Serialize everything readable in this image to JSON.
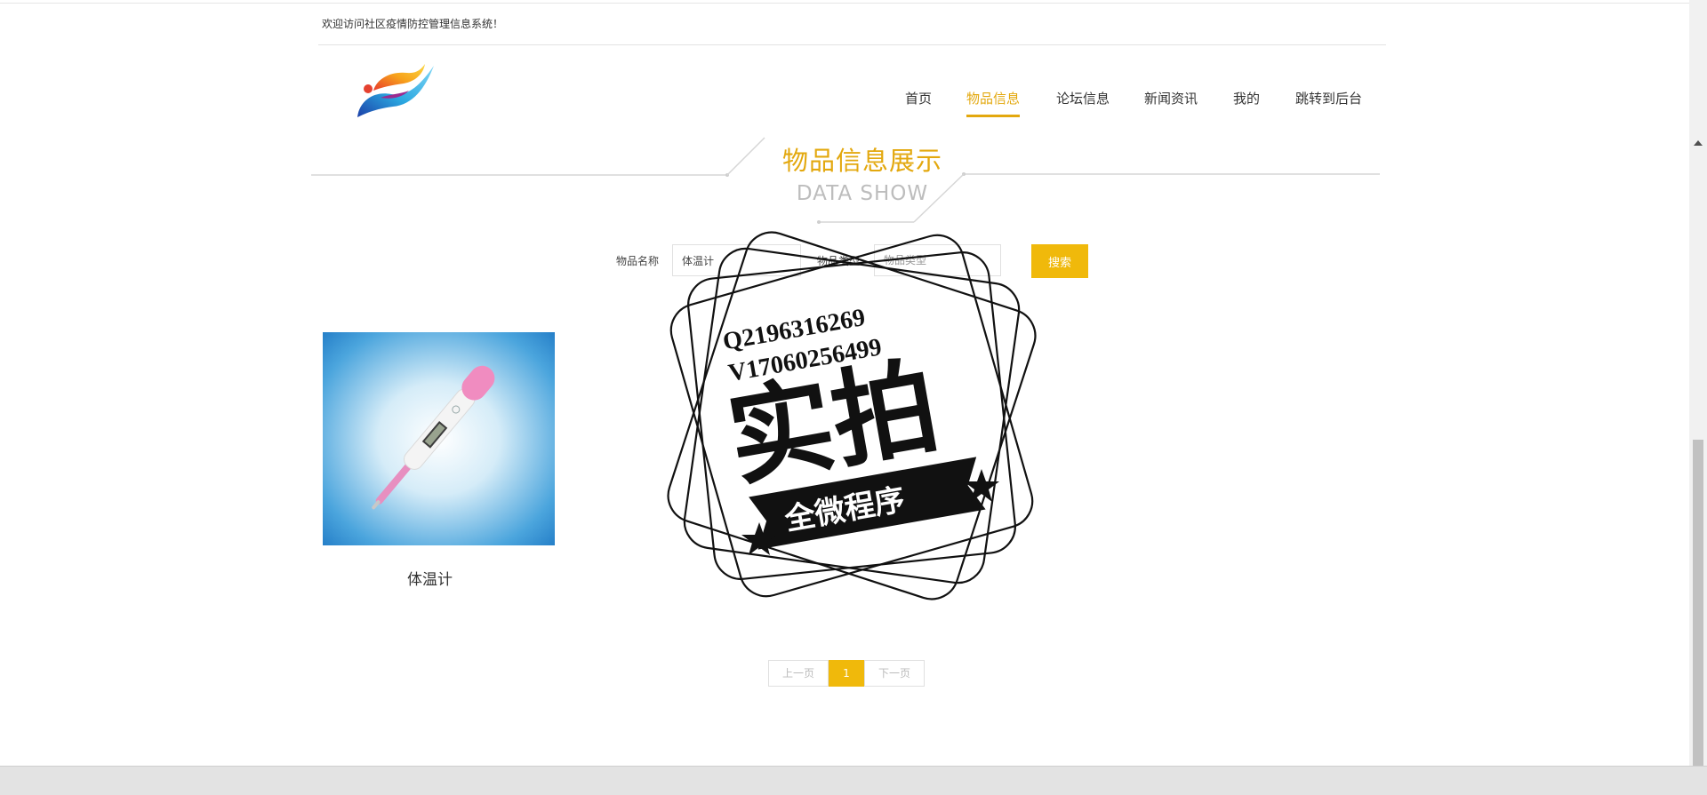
{
  "header": {
    "welcome": "欢迎访问社区疫情防控管理信息系统！"
  },
  "nav": {
    "items": [
      {
        "label": "首页"
      },
      {
        "label": "物品信息"
      },
      {
        "label": "论坛信息"
      },
      {
        "label": "新闻资讯"
      },
      {
        "label": "我的"
      },
      {
        "label": "跳转到后台"
      }
    ],
    "active": "物品信息",
    "accent_color": "#e3a80e"
  },
  "section": {
    "title_cn": "物品信息展示",
    "title_en": "DATA SHOW"
  },
  "search": {
    "name_label": "物品名称",
    "name_value": "体温计",
    "type_label": "物品类型",
    "type_placeholder": "物品类型",
    "button_label": "搜索",
    "button_color": "#f0b90b"
  },
  "products": [
    {
      "name": "体温计",
      "image_icon": "thermometer-image"
    }
  ],
  "pagination": {
    "prev": "上一页",
    "current": "1",
    "next": "下一页"
  },
  "watermark": {
    "line1": "Q2196316269",
    "line2": "V17060256499",
    "main": "实拍",
    "banner": "全微程序"
  }
}
